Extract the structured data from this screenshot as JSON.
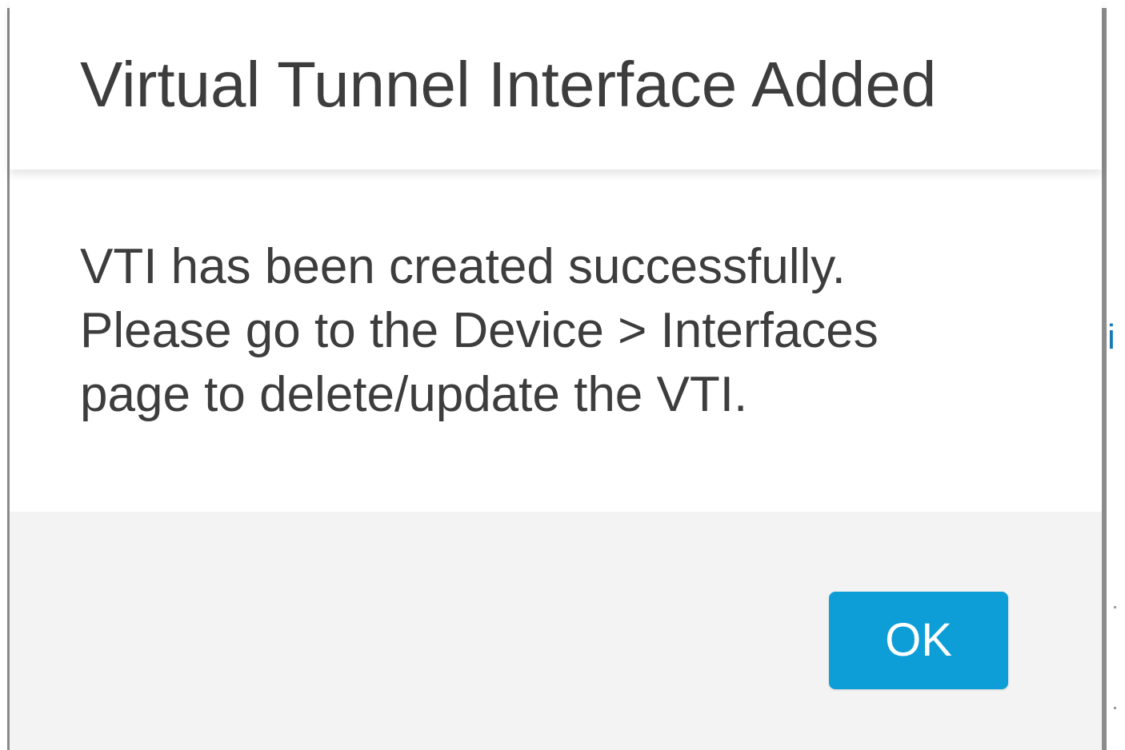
{
  "dialog": {
    "title": "Virtual Tunnel Interface Added",
    "message": "VTI has been created successfully. Please go to the Device > Interfaces page to delete/update the VTI.",
    "ok_label": "OK"
  },
  "background": {
    "peek_text": "i"
  },
  "colors": {
    "primary_button": "#0d9ed8",
    "footer_background": "#f3f3f3",
    "text": "#3d3d3d"
  }
}
